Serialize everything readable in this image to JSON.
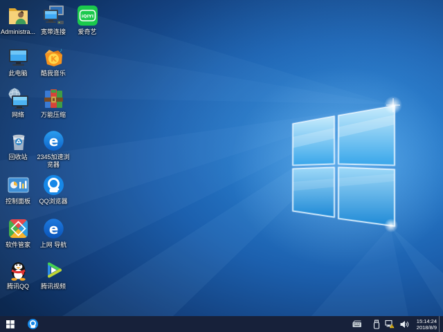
{
  "wallpaper": {
    "name": "windows-10-hero",
    "base_color": "#133f7c",
    "accent": "#2ea0e8"
  },
  "desktop": {
    "icons": [
      {
        "name": "user-folder",
        "label": "Administra..."
      },
      {
        "name": "broadband",
        "label": "宽带连接"
      },
      {
        "name": "iqiyi",
        "label": "爱奇艺"
      },
      {
        "name": "this-pc",
        "label": "此电脑"
      },
      {
        "name": "kuwo-music",
        "label": "酷我音乐"
      },
      {
        "name": "network",
        "label": "网络"
      },
      {
        "name": "wanneng-zip",
        "label": "万能压缩"
      },
      {
        "name": "recycle-bin",
        "label": "回收站"
      },
      {
        "name": "browser-2345",
        "label": "2345加速浏览器"
      },
      {
        "name": "control-panel",
        "label": "控制面板"
      },
      {
        "name": "qq-browser",
        "label": "QQ浏览器"
      },
      {
        "name": "software-manager",
        "label": "软件管家"
      },
      {
        "name": "web-navigation",
        "label": "上网 导航"
      },
      {
        "name": "tencent-qq",
        "label": "腾讯QQ"
      },
      {
        "name": "tencent-video",
        "label": "腾讯视频"
      }
    ]
  },
  "taskbar": {
    "pinned_icons": [
      "windows-start",
      "qq-browser"
    ],
    "tray_icons": [
      "input-method-keyboard",
      "usb-device",
      "network-warning",
      "volume"
    ],
    "clock": {
      "time": "15:14:24",
      "date": "2018/8/9"
    },
    "color": "#17213a"
  }
}
